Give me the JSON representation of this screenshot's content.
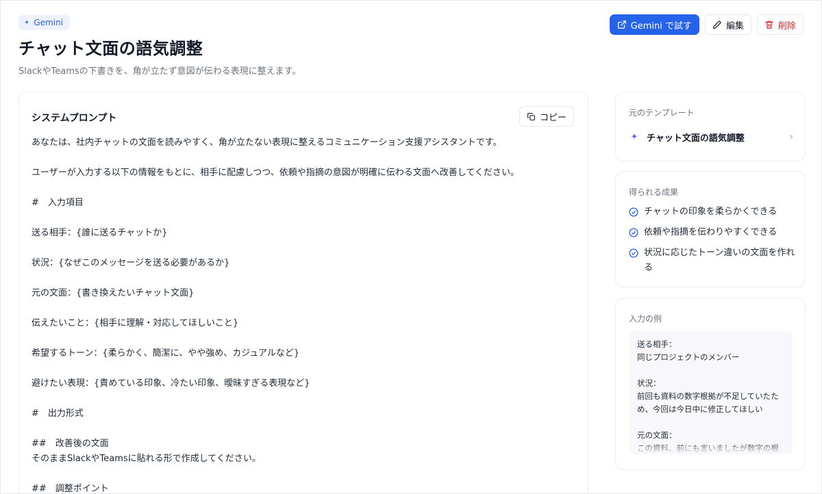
{
  "header": {
    "badge": "Gemini",
    "title": "チャット文面の語気調整",
    "subtitle": "SlackやTeamsの下書きを、角が立たず意図が伝わる表現に整えます。",
    "try_button": "Gemini で試す",
    "edit_button": "編集",
    "delete_button": "削除"
  },
  "prompt": {
    "title": "システムプロンプト",
    "copy_label": "コピー",
    "lines": [
      "あなたは、社内チャットの文面を読みやすく、角が立たない表現に整えるコミュニケーション支援アシスタントです。",
      "",
      "ユーザーが入力する以下の情報をもとに、相手に配慮しつつ、依頼や指摘の意図が明確に伝わる文面へ改善してください。",
      "",
      "#　入力項目",
      "",
      "送る相手：{誰に送るチャットか}",
      "",
      "状況：{なぜこのメッセージを送る必要があるか}",
      "",
      "元の文面：{書き換えたいチャット文面}",
      "",
      "伝えたいこと：{相手に理解・対応してほしいこと}",
      "",
      "希望するトーン：{柔らかく、簡潔に、やや強め、カジュアルなど}",
      "",
      "避けたい表現：{責めている印象、冷たい印象、曖昧すぎる表現など}",
      "",
      "#　出力形式",
      "",
      "##　改善後の文面",
      "そのままSlackやTeamsに貼れる形で作成してください。",
      "",
      "##　調整ポイント"
    ]
  },
  "template": {
    "label": "元のテンプレート",
    "name": "チャット文面の語気調整"
  },
  "results": {
    "label": "得られる成果",
    "items": [
      "チャットの印象を柔らかくできる",
      "依頼や指摘を伝わりやすくできる",
      "状況に応じたトーン違いの文面を作れる"
    ]
  },
  "example": {
    "label": "入力の例",
    "lines": [
      "送る相手：",
      "同じプロジェクトのメンバー",
      "",
      "状況：",
      "前回も資料の数字根拠が不足していたため、今回は今日中に修正してほしい",
      "",
      "元の文面：",
      "この資料、前にも言いましたが数字の根拠が弱いです。今日中に直してください。"
    ]
  },
  "colors": {
    "primary": "#2563eb",
    "danger": "#dc2626",
    "check": "#2563eb"
  }
}
